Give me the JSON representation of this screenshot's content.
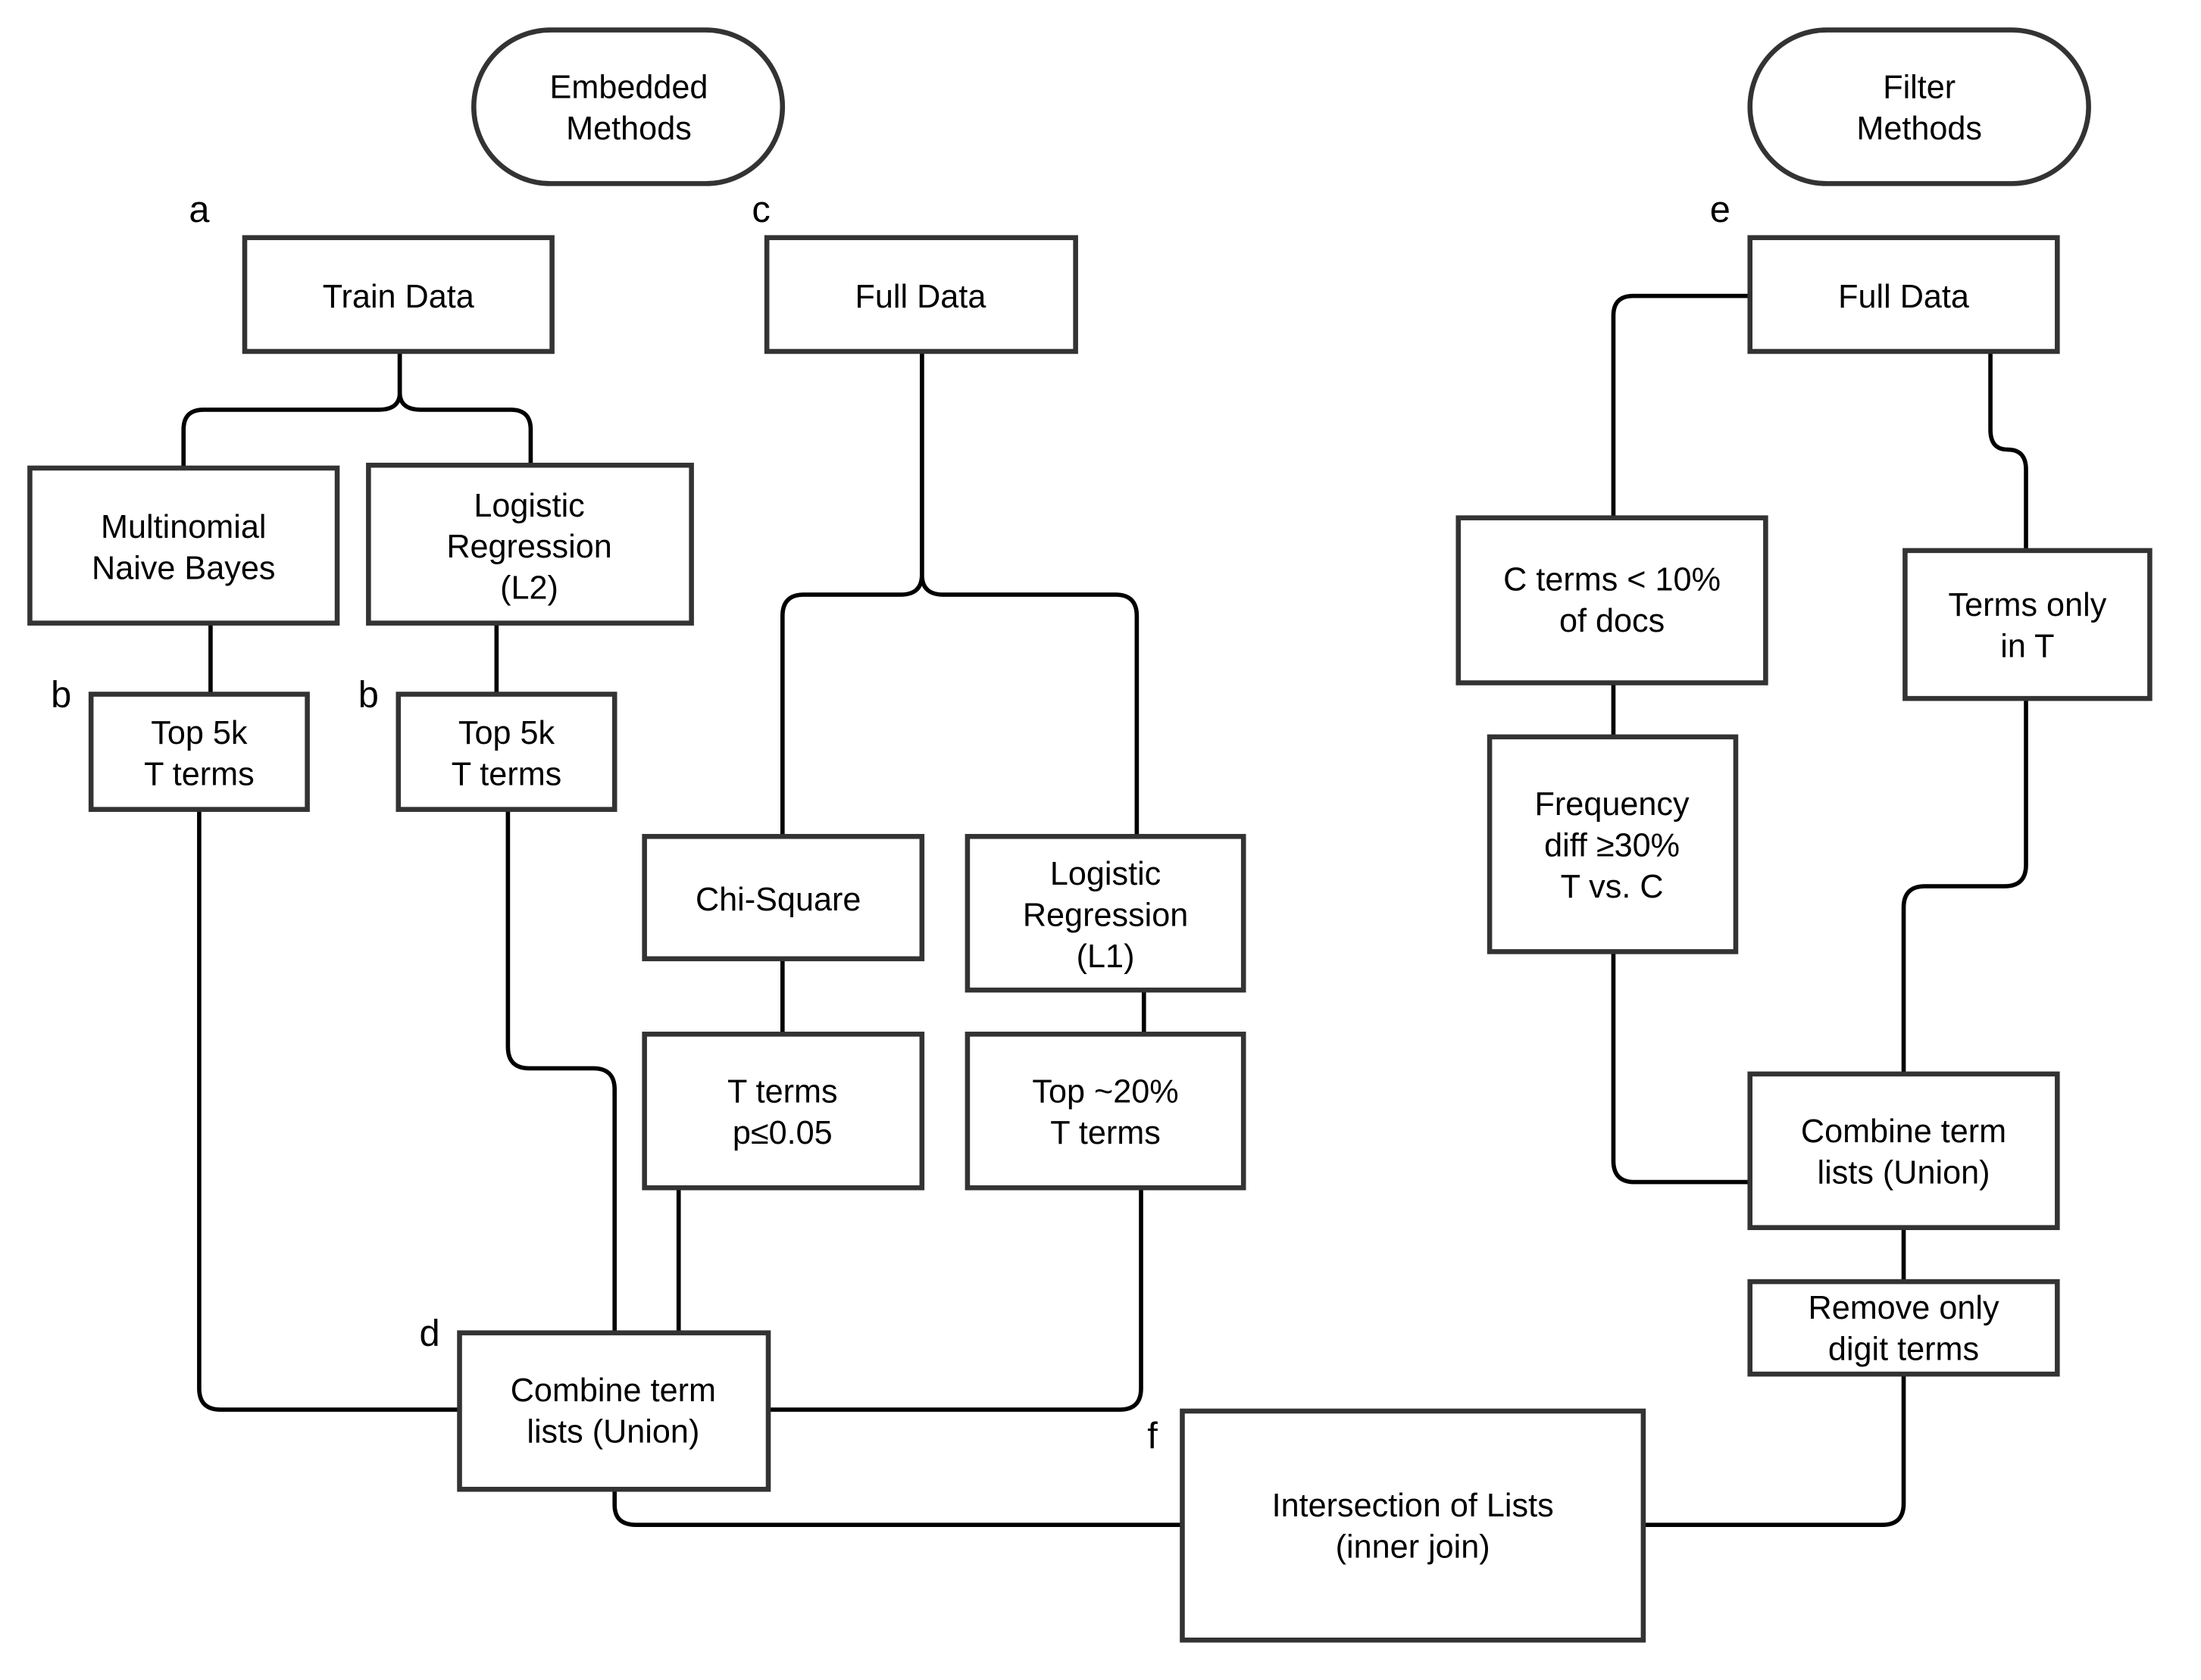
{
  "headers": {
    "embedded": [
      "Embedded",
      "Methods"
    ],
    "filter": [
      "Filter",
      "Methods"
    ]
  },
  "tags": {
    "a": "a",
    "b1": "b",
    "b2": "b",
    "c": "c",
    "d": "d",
    "e": "e",
    "f": "f"
  },
  "nodes": {
    "train_data": [
      "Train Data"
    ],
    "mnb": [
      "Multinomial",
      "Naive Bayes"
    ],
    "lr_l2": [
      "Logistic",
      "Regression",
      "(L2)"
    ],
    "top5k_mnb": [
      "Top 5k",
      "T terms"
    ],
    "top5k_lr": [
      "Top 5k",
      "T terms"
    ],
    "full_data_c": [
      "Full Data"
    ],
    "chi_square": [
      "Chi-Square"
    ],
    "lr_l1": [
      "Logistic",
      "Regression",
      "(L1)"
    ],
    "t_terms_p": [
      "T terms",
      "p≤0.05"
    ],
    "top20": [
      "Top ~20%",
      "T terms"
    ],
    "combine_d": [
      "Combine term",
      "lists (Union)"
    ],
    "full_data_e": [
      "Full Data"
    ],
    "c_terms": [
      "C terms < 10%",
      "of docs"
    ],
    "freq_diff": [
      "Frequency",
      "diff ≥30%",
      "T vs. C"
    ],
    "terms_only_t": [
      "Terms only",
      "in T"
    ],
    "combine_e": [
      "Combine term",
      "lists (Union)"
    ],
    "remove_digits": [
      "Remove only",
      "digit terms"
    ],
    "intersection": [
      "Intersection of Lists",
      "(inner join)"
    ]
  },
  "colors": {
    "box_stroke": "#333333",
    "connector": "#000000",
    "background": "#ffffff"
  }
}
